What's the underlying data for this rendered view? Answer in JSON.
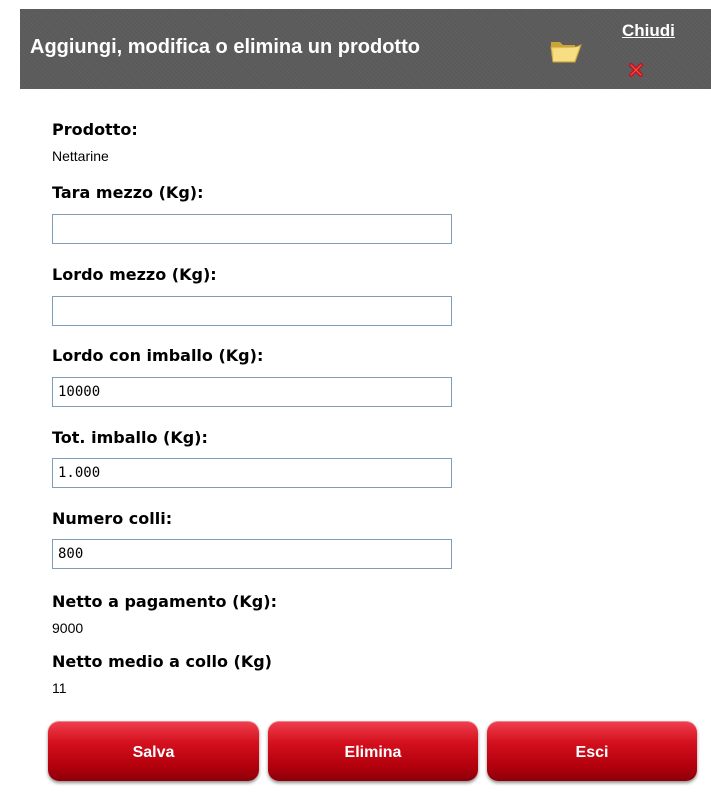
{
  "header": {
    "title": "Aggiungi, modifica o elimina un prodotto",
    "folder_icon": "folder-icon",
    "close_label": "Chiudi",
    "close_icon": "close-icon",
    "background_color": "#5a5a5a"
  },
  "fields": {
    "prodotto": {
      "label": "Prodotto:",
      "value": "Nettarine"
    },
    "tara_mezzo": {
      "label": "Tara mezzo (Kg):",
      "value": ""
    },
    "lordo_mezzo": {
      "label": "Lordo mezzo (Kg):",
      "value": ""
    },
    "lordo_imballo": {
      "label": "Lordo con imballo (Kg):",
      "value": "10000"
    },
    "tot_imballo": {
      "label": "Tot. imballo (Kg):",
      "value": "1.000"
    },
    "numero_colli": {
      "label": "Numero colli:",
      "value": "800"
    },
    "netto_pagamento": {
      "label": "Netto a pagamento (Kg):",
      "value": "9000"
    },
    "netto_medio": {
      "label": "Netto medio a collo (Kg)",
      "value": "11"
    }
  },
  "buttons": {
    "save_label": "Salva",
    "delete_label": "Elimina",
    "exit_label": "Esci",
    "color": "#c8101c"
  }
}
